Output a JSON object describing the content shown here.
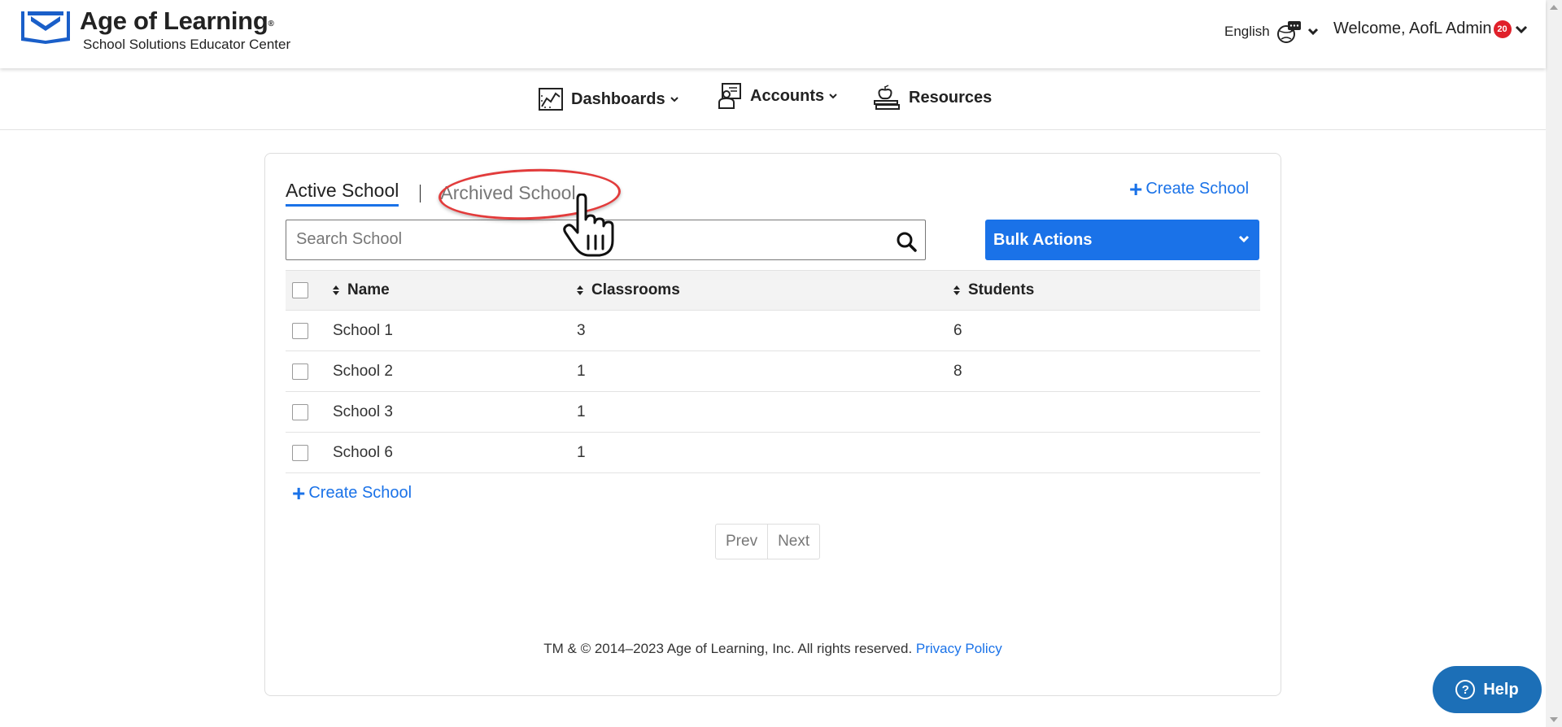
{
  "header": {
    "logo_title": "Age of Learning",
    "logo_trademark": "®",
    "logo_subtitle": "School Solutions Educator Center",
    "language": "English",
    "welcome": "Welcome, AofL Admin",
    "notification_count": "20"
  },
  "nav": {
    "items": [
      {
        "label": "Dashboards",
        "icon": "chart-icon",
        "has_dropdown": true
      },
      {
        "label": "Accounts",
        "icon": "teacher-icon",
        "has_dropdown": true
      },
      {
        "label": "Resources",
        "icon": "books-apple-icon",
        "has_dropdown": false
      }
    ]
  },
  "tabs": {
    "active": "Active School",
    "archived": "Archived School"
  },
  "actions": {
    "create_school": "Create School",
    "bulk_actions": "Bulk Actions"
  },
  "search": {
    "placeholder": "Search School",
    "value": ""
  },
  "table": {
    "columns": [
      "Name",
      "Classrooms",
      "Students"
    ],
    "rows": [
      {
        "name": "School 1",
        "classrooms": "3",
        "students": "6"
      },
      {
        "name": "School 2",
        "classrooms": "1",
        "students": "8"
      },
      {
        "name": "School 3",
        "classrooms": "1",
        "students": ""
      },
      {
        "name": "School 6",
        "classrooms": "1",
        "students": ""
      }
    ]
  },
  "pagination": {
    "prev": "Prev",
    "next": "Next"
  },
  "footer": {
    "copyright": "TM & © 2014–2023 Age of Learning, Inc. All rights reserved.",
    "privacy": "Privacy Policy"
  },
  "help": {
    "label": "Help"
  },
  "colors": {
    "accent": "#1a72e8",
    "highlight_circle": "#e23b3b",
    "badge": "#e0202a",
    "help_button": "#1c6fb7"
  }
}
